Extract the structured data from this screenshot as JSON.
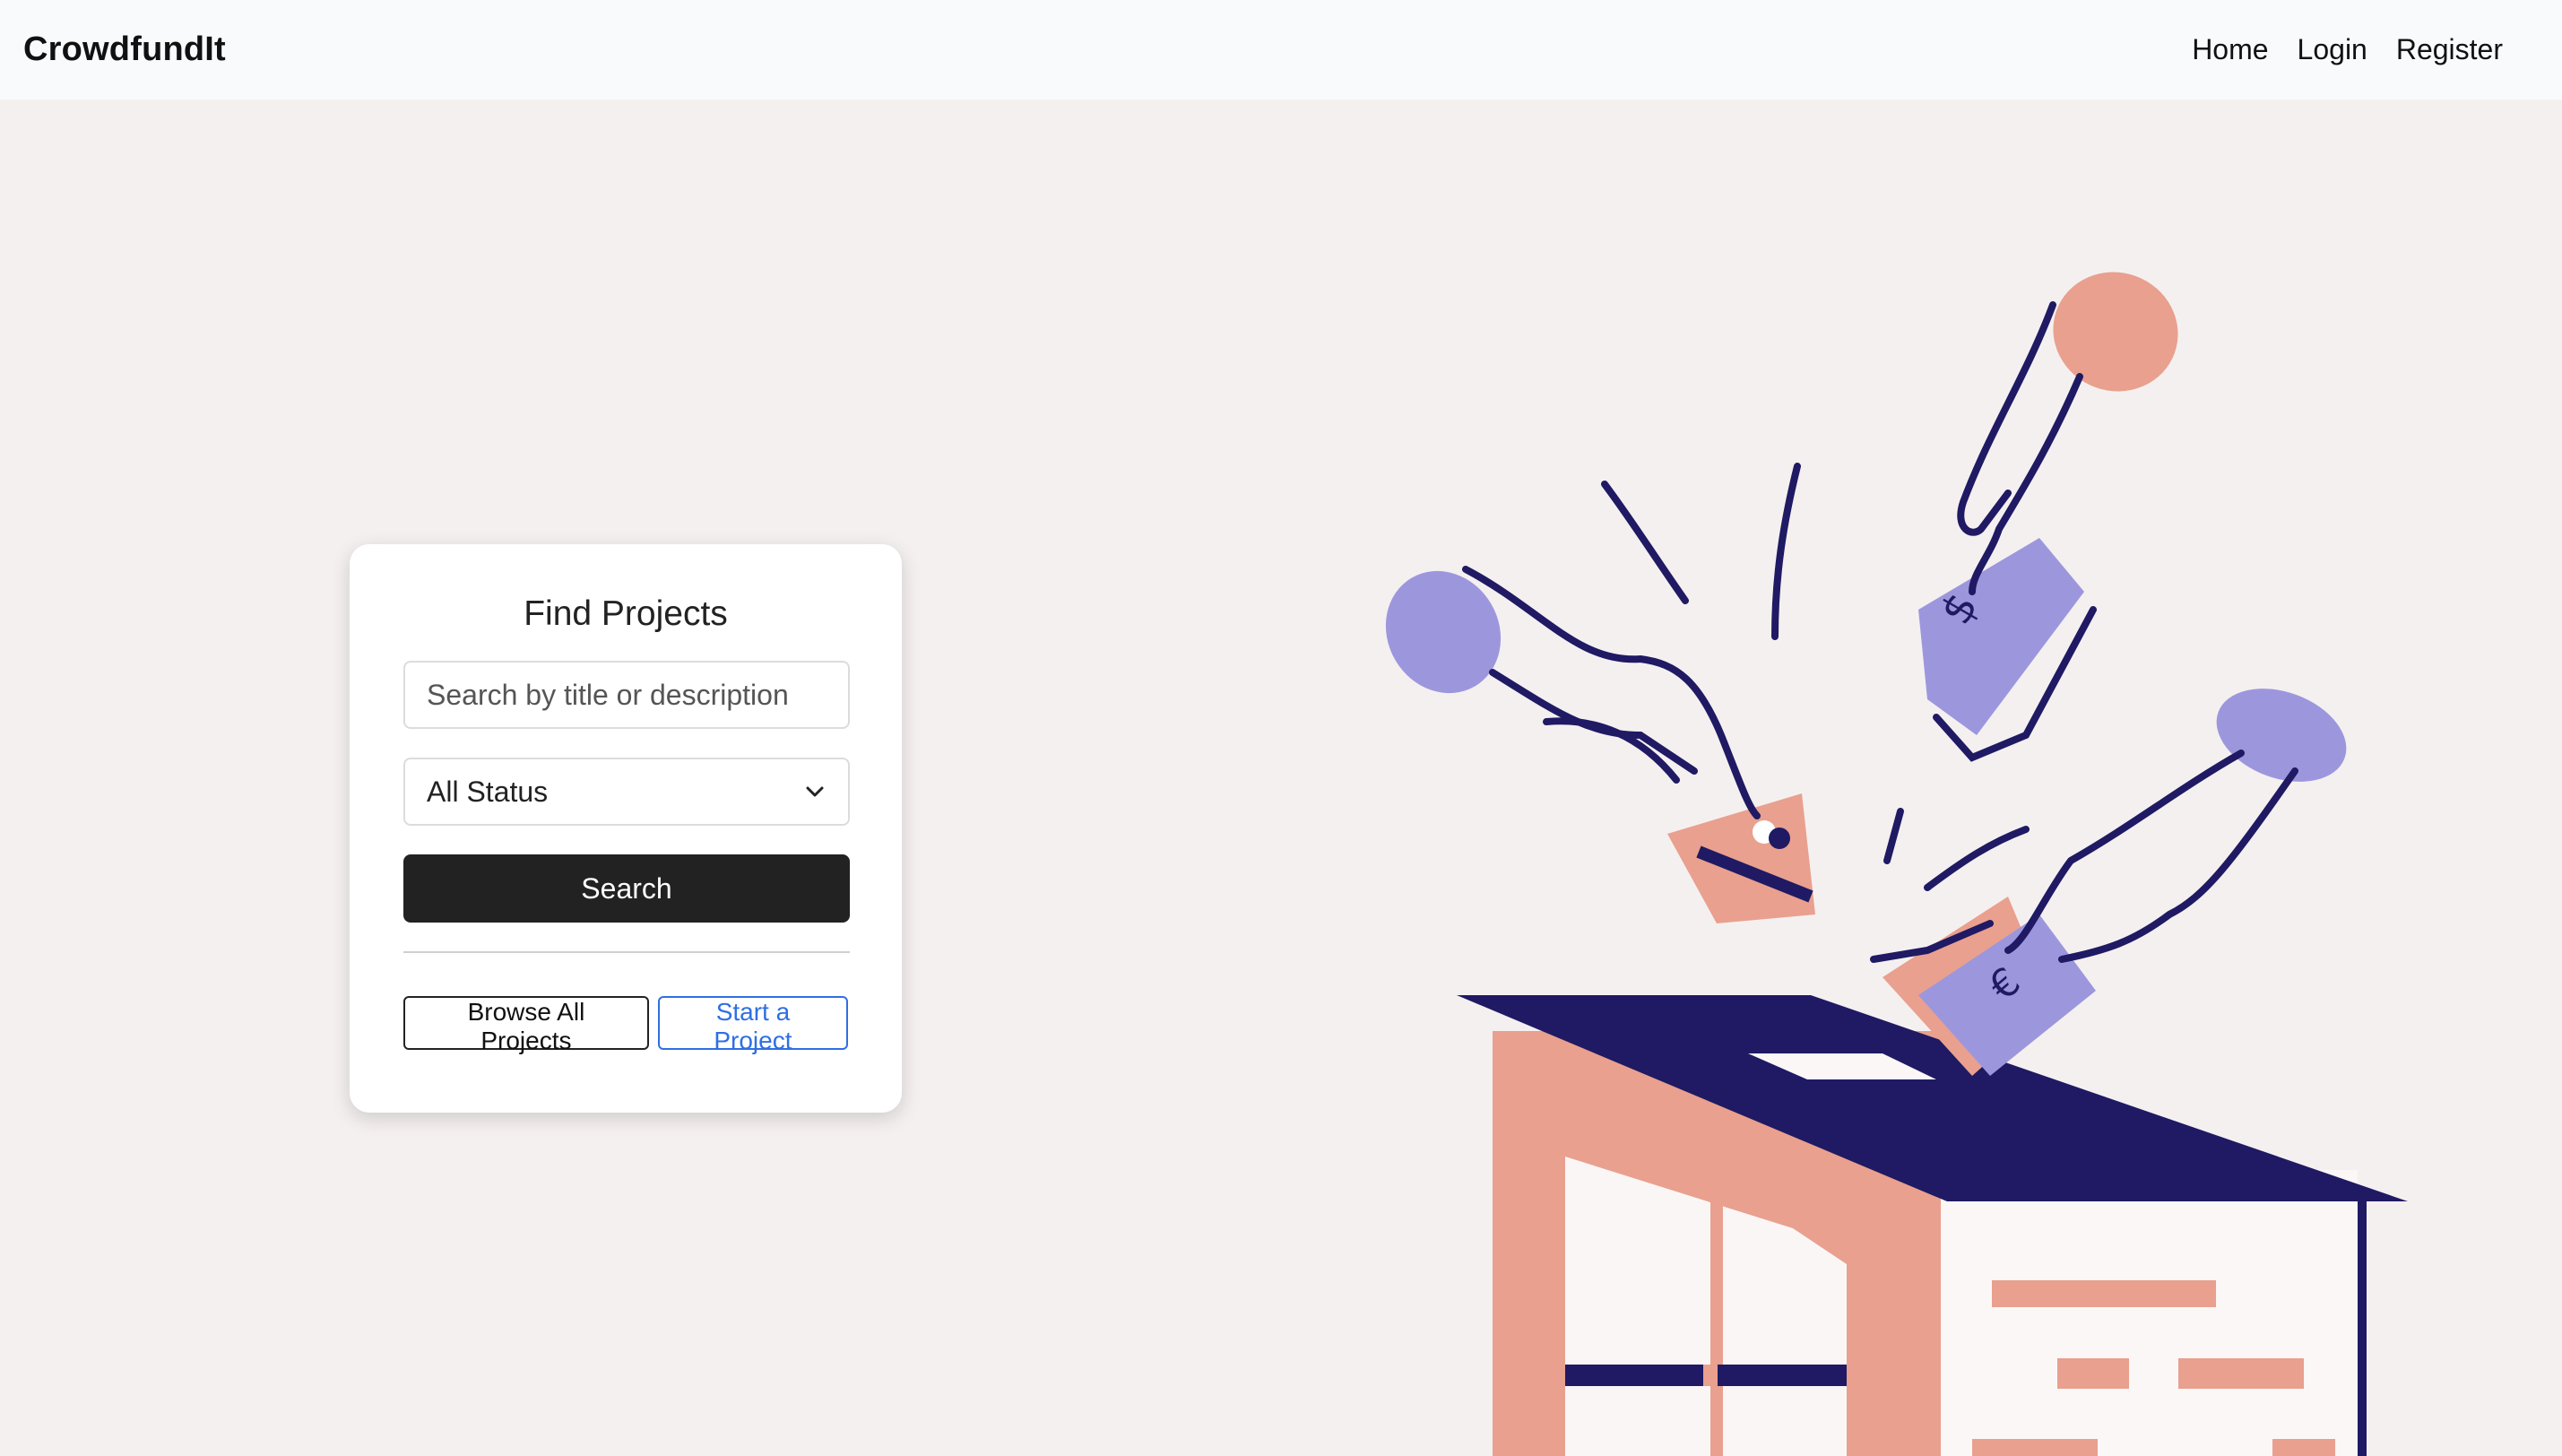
{
  "navbar": {
    "brand": "CrowdfundIt",
    "links": [
      "Home",
      "Login",
      "Register"
    ]
  },
  "search_card": {
    "title": "Find Projects",
    "search_placeholder": "Search by title or description",
    "status_selected": "All Status",
    "search_button": "Search",
    "browse_button": "Browse All Projects",
    "start_button": "Start a Project"
  },
  "illustration": {
    "description_icon": "donation-box-illustration",
    "colors": {
      "navy": "#1f1a63",
      "salmon": "#e9a08e",
      "lavender": "#9c97dd",
      "white": "#ffffff"
    }
  },
  "colors": {
    "background": "#f5f0f0",
    "navbar_bg": "#f9fafb",
    "primary_button": "#222222",
    "link_blue": "#2f6fe4"
  }
}
